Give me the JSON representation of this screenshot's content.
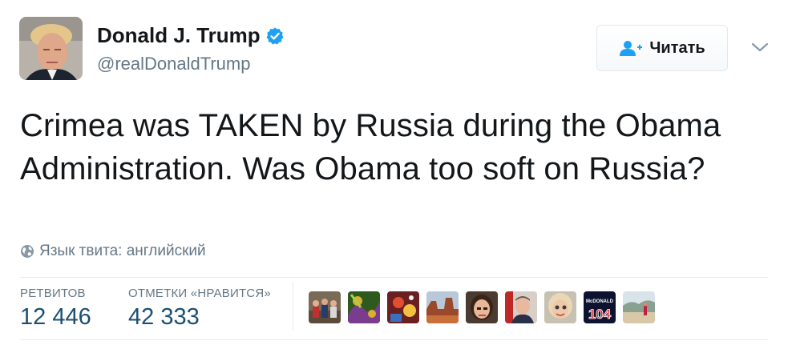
{
  "author": {
    "name": "Donald J. Trump",
    "handle": "@realDonaldTrump",
    "verified": true,
    "avatar_icon": "profile-photo"
  },
  "follow_button": {
    "label": "Читать",
    "icon": "add-user-icon"
  },
  "menu_icon": "chevron-down-icon",
  "tweet": {
    "text": "Crimea was TAKEN by Russia during the Obama Administration. Was Obama too soft on Russia?",
    "language_label": "Язык твита: английский"
  },
  "stats": {
    "retweets_label": "РЕТВИТОВ",
    "retweets_value": "12 446",
    "likes_label": "ОТМЕТКИ «НРАВИТСЯ»",
    "likes_value": "42 333"
  },
  "liker_avatars": [
    {
      "name": "liker-avatar-1"
    },
    {
      "name": "liker-avatar-2"
    },
    {
      "name": "liker-avatar-3"
    },
    {
      "name": "liker-avatar-4"
    },
    {
      "name": "liker-avatar-5"
    },
    {
      "name": "liker-avatar-6"
    },
    {
      "name": "liker-avatar-7"
    },
    {
      "name": "liker-avatar-8",
      "text": "104",
      "subtext": "McDONALD"
    },
    {
      "name": "liker-avatar-9"
    }
  ],
  "colors": {
    "text": "#14171a",
    "secondary": "#657786",
    "verified_blue": "#1da1f2",
    "stat_value": "#1b4f72",
    "divider": "#e6ecf0"
  }
}
